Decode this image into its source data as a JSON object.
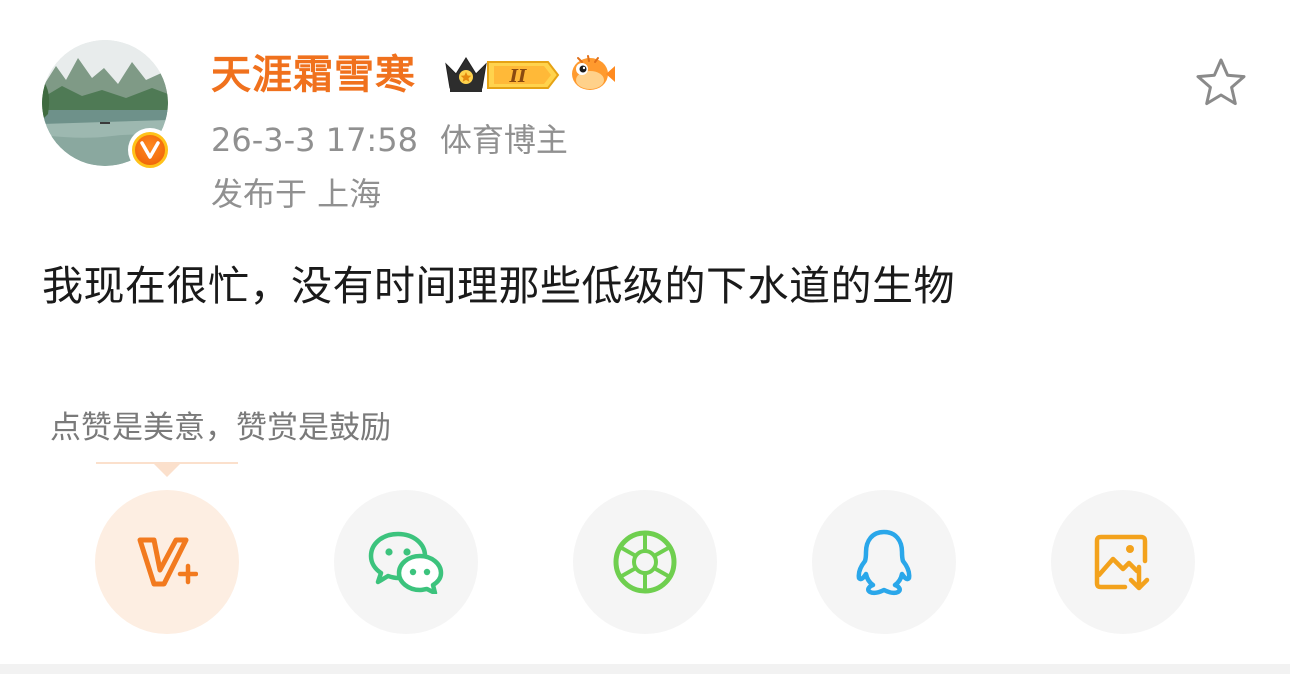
{
  "post": {
    "author": {
      "name": "天涯霜雪寒",
      "avatar_icon": "landscape-avatar",
      "verified_badge_icon": "orange-v-verified-icon",
      "crown_badge_icon": "crown-level-badge-icon",
      "crown_badge_level": "II",
      "fan_badge_icon": "pufferfish-icon"
    },
    "timestamp": "26-3-3 17:58",
    "role": "体育博主",
    "location": "发布于 上海",
    "text": "我现在很忙，没有时间理那些低级的下水道的生物",
    "favorite_icon": "star-outline-icon"
  },
  "reward": {
    "tip_label": "点赞是美意，赞赏是鼓励"
  },
  "share_buttons": [
    {
      "name": "v-plus",
      "icon": "v-plus-icon",
      "color": "#f27a1f"
    },
    {
      "name": "wechat",
      "icon": "wechat-icon",
      "color": "#3cc37d"
    },
    {
      "name": "moments",
      "icon": "aperture-icon",
      "color": "#6fcf4f"
    },
    {
      "name": "qq",
      "icon": "qq-penguin-icon",
      "color": "#2aa7ea"
    },
    {
      "name": "save-image",
      "icon": "save-image-icon",
      "color": "#f3a21c"
    }
  ],
  "colors": {
    "username": "#f0711d",
    "meta_text": "#909090",
    "body_text": "#1a1a1a",
    "tip_text": "#7a7a7a"
  }
}
